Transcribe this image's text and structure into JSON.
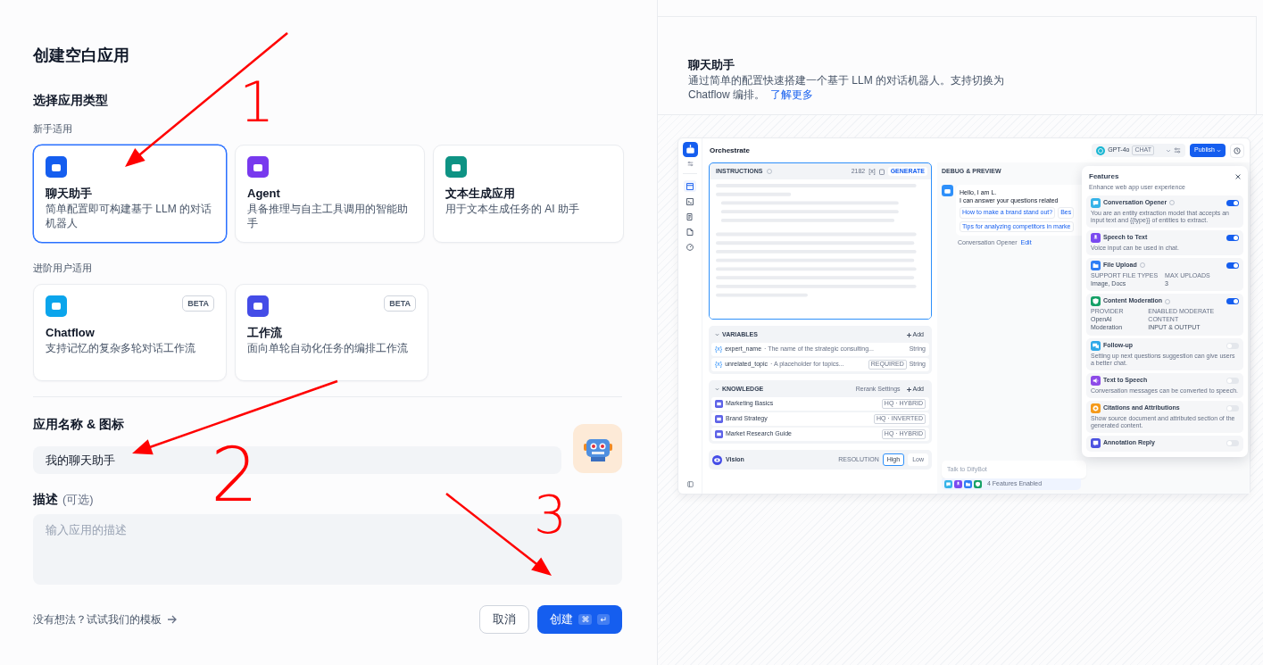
{
  "dialog": {
    "title": "创建空白应用",
    "type_heading": "选择应用类型",
    "beginner_label": "新手适用",
    "beginner_types": [
      {
        "kind": "chat",
        "name": "聊天助手",
        "description": "简单配置即可构建基于 LLM 的对话机器人",
        "selected": true
      },
      {
        "kind": "agent",
        "name": "Agent",
        "description": "具备推理与自主工具调用的智能助手",
        "selected": false
      },
      {
        "kind": "completion",
        "name": "文本生成应用",
        "description": "用于文本生成任务的 AI 助手",
        "selected": false
      }
    ],
    "advanced_label": "进阶用户适用",
    "advanced_types": [
      {
        "kind": "chatflow",
        "name": "Chatflow",
        "description": "支持记忆的复杂多轮对话工作流",
        "badge": "BETA",
        "selected": false
      },
      {
        "kind": "workflow",
        "name": "工作流",
        "description": "面向单轮自动化任务的编排工作流",
        "badge": "BETA",
        "selected": false
      }
    ],
    "name_label": "应用名称 & 图标",
    "name_value": "我的聊天助手",
    "description_label": "描述",
    "description_hint": "(可选)",
    "description_placeholder": "输入应用的描述",
    "template_link": "没有想法？试试我们的模板",
    "cancel": "取消",
    "create": "创建",
    "shortcut_keys": [
      "⌘",
      "↵"
    ]
  },
  "preview": {
    "title": "聊天助手",
    "description": "通过简单的配置快速搭建一个基于 LLM 的对话机器人。支持切换为 Chatflow 编排。",
    "learn_more": "了解更多",
    "screenshot": {
      "nav": [
        {
          "kind": "layout",
          "selected": true
        },
        {
          "kind": "terminal",
          "selected": false
        },
        {
          "kind": "doc",
          "selected": false
        },
        {
          "kind": "note",
          "selected": false
        },
        {
          "kind": "gauge",
          "selected": false
        }
      ],
      "title": "Orchestrate",
      "model": "GPT-4o",
      "model_tag": "CHAT",
      "publish": "Publish",
      "instructions": {
        "label": "INSTRUCTIONS",
        "count": "2182",
        "var_symbol": "[x]",
        "generate": "GENERATE"
      },
      "variables": {
        "label": "VARIABLES",
        "add": "Add",
        "rows": [
          {
            "icon_text": "{x}",
            "name": "expert_name",
            "description": "· The name of the strategic consulting...",
            "type": "String"
          },
          {
            "icon_text": "{x}",
            "name": "unrelated_topic",
            "description": "· A placeholder for topics...",
            "badge": "REQUIRED",
            "type": "String"
          }
        ]
      },
      "knowledge": {
        "label": "KNOWLEDGE",
        "rerank": "Rerank Settings",
        "add": "Add",
        "items": [
          {
            "name": "Marketing Basics",
            "tag": "HQ · HYBRID"
          },
          {
            "name": "Brand Strategy",
            "tag": "HQ · INVERTED"
          },
          {
            "name": "Market Research Guide",
            "tag": "HQ · HYBRID"
          }
        ]
      },
      "vision": {
        "label": "Vision",
        "resolution": "RESOLUTION",
        "options": [
          {
            "label": "High",
            "selected": true
          },
          {
            "label": "Low",
            "selected": false
          }
        ]
      },
      "debug": {
        "title": "DEBUG & PREVIEW",
        "greeting": [
          "Hello, I am L.",
          "I can answer your questions related"
        ],
        "suggestions": [
          "How to make a brand stand out?",
          "Bes",
          "Tips for analyzing competitors in marke"
        ],
        "opener_label": "Conversation Opener",
        "edit": "Edit",
        "input_placeholder": "Talk to DifyBot",
        "features_enabled": "4 Features Enabled"
      },
      "features": {
        "title": "Features",
        "subtitle": "Enhance web app user experience",
        "items": [
          {
            "kind": "opener",
            "name": "Conversation Opener",
            "help": true,
            "on": true,
            "color": "#36b3e8",
            "description": "You are an entity extraction model that accepts an input text and {{type}} of entities to extract."
          },
          {
            "kind": "speech",
            "name": "Speech to Text",
            "help": false,
            "on": true,
            "color": "#7a4af0",
            "description": "Voice input can be used in chat."
          },
          {
            "kind": "file",
            "name": "File Upload",
            "help": true,
            "on": true,
            "color": "#2f7ef5",
            "fields": [
              {
                "label": "SUPPORT FILE TYPES",
                "value": "Image, Docs"
              },
              {
                "label": "MAX UPLOADS",
                "value": "3"
              }
            ]
          },
          {
            "kind": "moderation",
            "name": "Content Moderation",
            "help": true,
            "on": true,
            "color": "#16a167",
            "fields": [
              {
                "label": "PROVIDER",
                "value": "OpenAI Moderation"
              },
              {
                "label": "ENABLED MODERATE CONTENT",
                "value": "INPUT & OUTPUT"
              }
            ]
          },
          {
            "kind": "followup",
            "name": "Follow-up",
            "help": false,
            "on": false,
            "color": "#2fa8e8",
            "description": "Setting up next questions suggestion can give users a better chat."
          },
          {
            "kind": "tts",
            "name": "Text to Speech",
            "help": false,
            "on": false,
            "color": "#8d4be8",
            "description": "Conversation messages can be converted to speech."
          },
          {
            "kind": "citation",
            "name": "Citations and Attributions",
            "help": false,
            "on": false,
            "color": "#f59a1a",
            "description": "Show source document and attributed section of the generated content."
          },
          {
            "kind": "annotation",
            "name": "Annotation Reply",
            "help": false,
            "on": false,
            "color": "#4b52e0"
          }
        ]
      }
    }
  },
  "annotation_marks": [
    "1",
    "2",
    "3"
  ]
}
